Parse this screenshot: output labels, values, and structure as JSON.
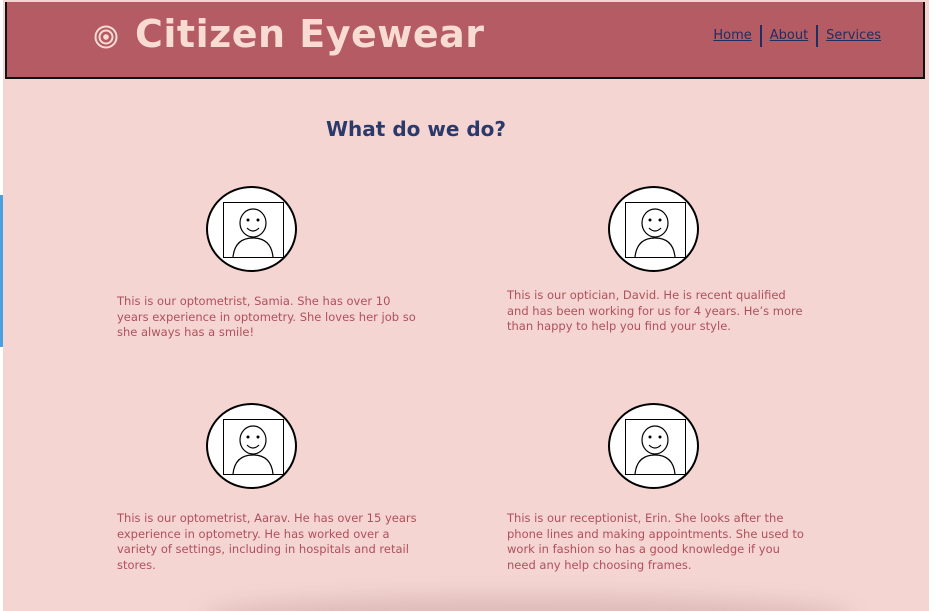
{
  "header": {
    "site_title": "Citizen Eyewear",
    "nav": [
      "Home",
      "About",
      "Services"
    ]
  },
  "main": {
    "section_title": "What do we do?",
    "staff": [
      {
        "bio": "This is our optometrist, Samia. She has over 10 years experience in optometry. She loves her job so she always has a smile!"
      },
      {
        "bio": "This is our optician, David. He is recent qualified and has been working for us for 4 years. He’s more than happy to help you find your style."
      },
      {
        "bio": "This is our optometrist, Aarav. He has over 15 years experience in optometry. He has worked over a variety of settings, including in hospitals and retail stores."
      },
      {
        "bio": "This is our receptionist, Erin. She looks after the phone lines and making appointments. She used to work in fashion so has a good knowledge if you need any help choosing frames."
      }
    ]
  },
  "colors": {
    "header_bg": "#b45b63",
    "page_bg": "#f4d5d1",
    "title_text": "#f8dcd4",
    "nav_link": "#1e2e5e",
    "heading": "#2b3a6b",
    "body_text": "#b0505c"
  },
  "icons": {
    "logo": "concentric-circles-icon",
    "avatar": "person-placeholder-icon"
  }
}
